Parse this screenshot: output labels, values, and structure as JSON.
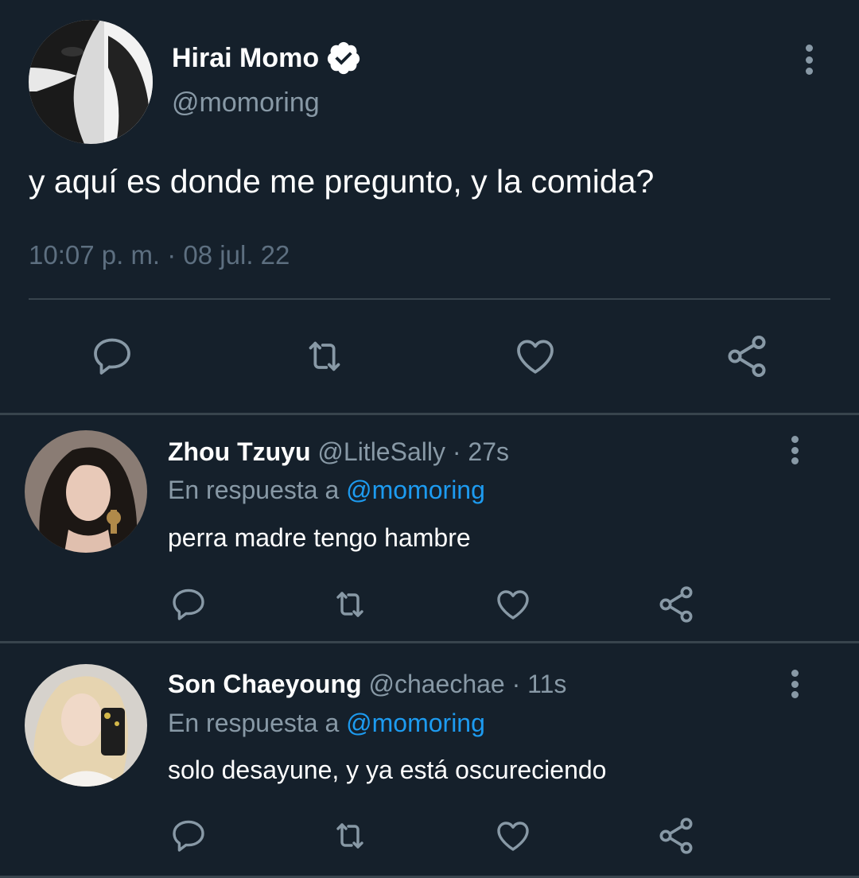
{
  "main_tweet": {
    "name": "Hirai Momo",
    "handle": "@momoring",
    "text": "y aquí es donde me pregunto, y la comida?",
    "timestamp": "10:07 p. m. · 08 jul. 22",
    "verified": true
  },
  "replies": [
    {
      "name": "Zhou Tzuyu",
      "handle": "@LitleSally",
      "age": "· 27s",
      "reply_prefix": "En respuesta a",
      "mention": "@momoring",
      "text": "perra madre tengo hambre"
    },
    {
      "name": "Son Chaeyoung",
      "handle": "@chaechae",
      "age": "· 11s",
      "reply_prefix": "En respuesta a",
      "mention": "@momoring",
      "text": "solo desayune, y ya está oscureciendo"
    }
  ],
  "icons": {
    "reply": "speech-bubble-icon",
    "retweet": "retweet-icon",
    "like": "heart-icon",
    "share": "share-nodes-icon",
    "more": "vertical-ellipsis-icon",
    "verified": "verified-badge-icon"
  },
  "colors": {
    "background": "#15202b",
    "primary_text": "#ffffff",
    "secondary_text": "#8899a6",
    "link": "#1d9bf0",
    "icon": "#8899a6",
    "divider": "#38444d"
  }
}
